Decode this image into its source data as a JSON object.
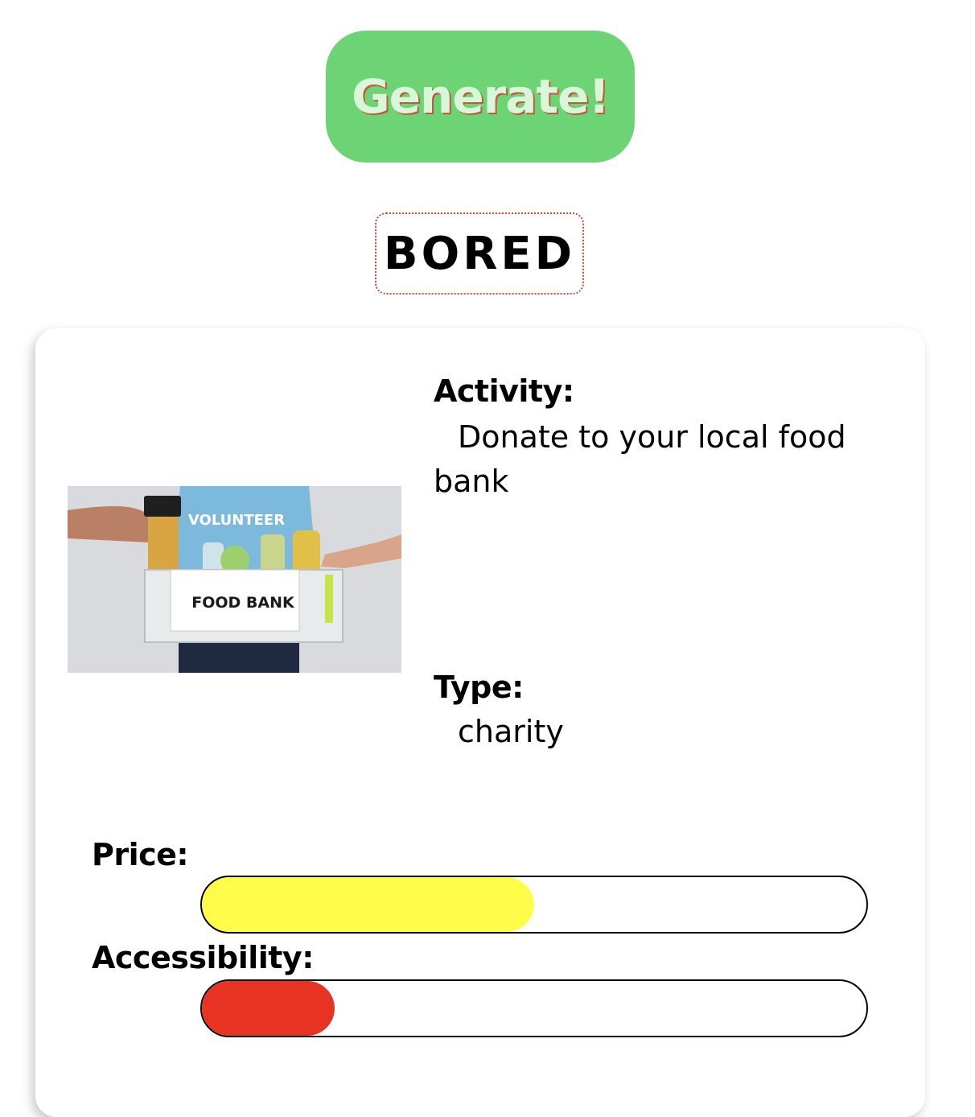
{
  "header": {
    "generate_label": "Generate!",
    "logo_text": "BORED"
  },
  "activity": {
    "label": "Activity:",
    "value": "Donate to your local food bank"
  },
  "image": {
    "sign_text": "FOOD BANK",
    "shirt_text": "VOLUNTEER"
  },
  "type": {
    "label": "Type:",
    "value": "charity"
  },
  "price": {
    "label": "Price:",
    "level": 0.5,
    "color": "#fffc4a"
  },
  "accessibility": {
    "label": "Accessibility:",
    "level": 0.2,
    "color": "#e93322"
  },
  "colors": {
    "generate_bg": "#6cd475",
    "logo_border": "#e0433a"
  }
}
